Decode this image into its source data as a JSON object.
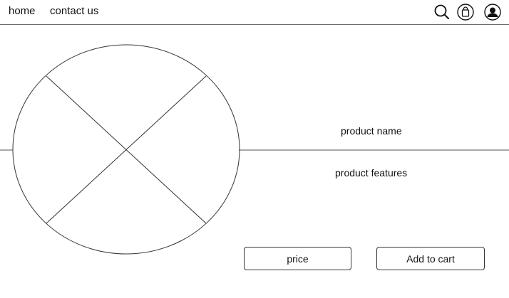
{
  "nav": {
    "links": [
      {
        "label": "home"
      },
      {
        "label": "contact us"
      }
    ],
    "icons": [
      "search-icon",
      "shopping-bag-icon",
      "user-account-icon"
    ]
  },
  "product": {
    "name": "product name",
    "features": "product features",
    "price_label": "price",
    "add_to_cart_label": "Add to cart"
  }
}
